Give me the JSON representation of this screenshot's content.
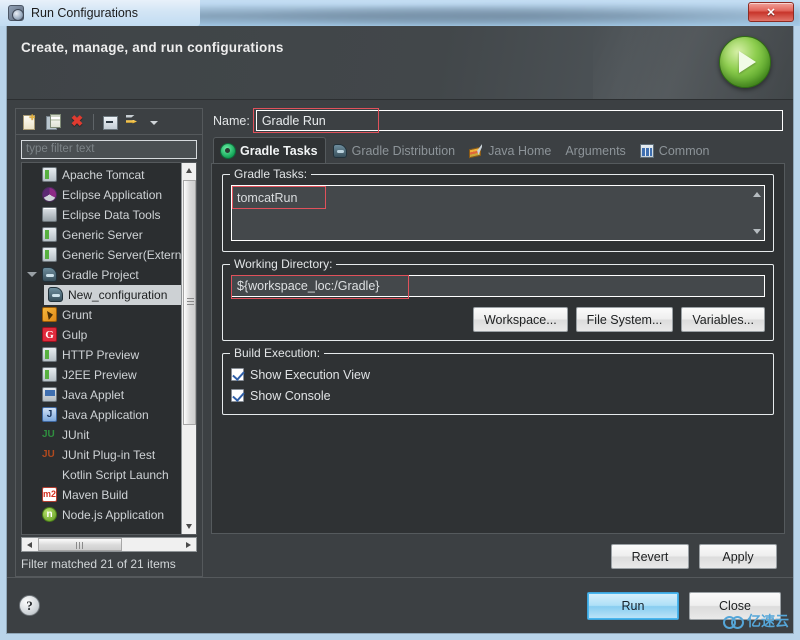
{
  "window": {
    "title": "Run Configurations",
    "close_label": "✕"
  },
  "banner": {
    "title": "Create, manage, and run configurations",
    "icon": "run-play-badge"
  },
  "left_pane": {
    "toolbar": [
      {
        "name": "new-configuration-icon",
        "label": "New launch configuration"
      },
      {
        "name": "duplicate-icon",
        "label": "Duplicate currently selected launch configuration"
      },
      {
        "name": "delete-icon",
        "label": "Delete selected launch configuration(s)"
      },
      {
        "name": "collapse-all-icon",
        "label": "Collapse All"
      },
      {
        "name": "filter-launch-icon",
        "label": "Filter launch configurations"
      },
      {
        "name": "chevron-down-icon",
        "label": "Menu"
      }
    ],
    "filter": {
      "placeholder": "type filter text",
      "value": ""
    },
    "tree": [
      {
        "label": "Apache Tomcat",
        "icon": "server-icon",
        "indent": 0,
        "selected": false,
        "twisty": false
      },
      {
        "label": "Eclipse Application",
        "icon": "eclipse-icon",
        "indent": 0,
        "selected": false,
        "twisty": false
      },
      {
        "label": "Eclipse Data Tools",
        "icon": "data-tools-icon",
        "indent": 0,
        "selected": false,
        "twisty": false
      },
      {
        "label": "Generic Server",
        "icon": "server-icon",
        "indent": 0,
        "selected": false,
        "twisty": false
      },
      {
        "label": "Generic Server(Externa",
        "icon": "server-icon",
        "indent": 0,
        "selected": false,
        "twisty": false
      },
      {
        "label": "Gradle Project",
        "icon": "gradle-icon",
        "indent": 0,
        "selected": false,
        "twisty": true
      },
      {
        "label": "New_configuration",
        "icon": "gradle-icon",
        "indent": 1,
        "selected": true,
        "twisty": false
      },
      {
        "label": "Grunt",
        "icon": "grunt-icon",
        "indent": 0,
        "selected": false,
        "twisty": false
      },
      {
        "label": "Gulp",
        "icon": "gulp-icon",
        "indent": 0,
        "selected": false,
        "twisty": false
      },
      {
        "label": "HTTP Preview",
        "icon": "server-icon",
        "indent": 0,
        "selected": false,
        "twisty": false
      },
      {
        "label": "J2EE Preview",
        "icon": "server-icon",
        "indent": 0,
        "selected": false,
        "twisty": false
      },
      {
        "label": "Java Applet",
        "icon": "java-applet-icon",
        "indent": 0,
        "selected": false,
        "twisty": false
      },
      {
        "label": "Java Application",
        "icon": "java-application-icon",
        "indent": 0,
        "selected": false,
        "twisty": false
      },
      {
        "label": "JUnit",
        "icon": "junit-icon",
        "indent": 0,
        "selected": false,
        "twisty": false
      },
      {
        "label": "JUnit Plug-in Test",
        "icon": "junit-plugin-icon",
        "indent": 0,
        "selected": false,
        "twisty": false
      },
      {
        "label": "Kotlin Script Launch",
        "icon": "blank-icon",
        "indent": 0,
        "selected": false,
        "twisty": false
      },
      {
        "label": "Maven Build",
        "icon": "maven-icon",
        "indent": 0,
        "selected": false,
        "twisty": false
      },
      {
        "label": "Node.js Application",
        "icon": "nodejs-icon",
        "indent": 0,
        "selected": false,
        "twisty": false
      }
    ],
    "icon_glyphs": {
      "gulp": "G",
      "java_application": "J",
      "junit": "JU",
      "junit_plugin": "JU",
      "maven": "m2",
      "nodejs": "n"
    },
    "status": "Filter matched 21 of 21 items"
  },
  "right_pane": {
    "name_label": "Name:",
    "name_value": "Gradle Run",
    "tabs": [
      {
        "label": "Gradle Tasks",
        "icon": "gradle-gear-icon",
        "active": true
      },
      {
        "label": "Gradle Distribution",
        "icon": "gradle-distribution-icon",
        "active": false
      },
      {
        "label": "Java Home",
        "icon": "java-home-icon",
        "active": false
      },
      {
        "label": "Arguments",
        "icon": "",
        "active": false
      },
      {
        "label": "Common",
        "icon": "common-icon",
        "active": false
      }
    ],
    "gradle_tasks": {
      "group_label": "Gradle Tasks:",
      "value": "tomcatRun"
    },
    "working_directory": {
      "group_label": "Working Directory:",
      "value": "${workspace_loc:/Gradle}",
      "buttons": [
        "Workspace...",
        "File System...",
        "Variables..."
      ]
    },
    "build_execution": {
      "group_label": "Build Execution:",
      "checkboxes": [
        {
          "label": "Show Execution View",
          "checked": true
        },
        {
          "label": "Show Console",
          "checked": true
        }
      ]
    },
    "actions": {
      "revert": "Revert",
      "apply": "Apply"
    }
  },
  "footer": {
    "help": "?",
    "run": "Run",
    "close": "Close"
  },
  "watermark": {
    "text": "亿速云"
  },
  "colors": {
    "dialog_bg": "#3c4043",
    "panel_bg": "#2f3234",
    "tree_bg": "#2b2e30",
    "text": "#e3e6e8",
    "highlight_red": "#e0515b",
    "run_accent": "#87cdf0",
    "title_blue": "#c2dcf2",
    "green_badge": "#4f9e23"
  }
}
